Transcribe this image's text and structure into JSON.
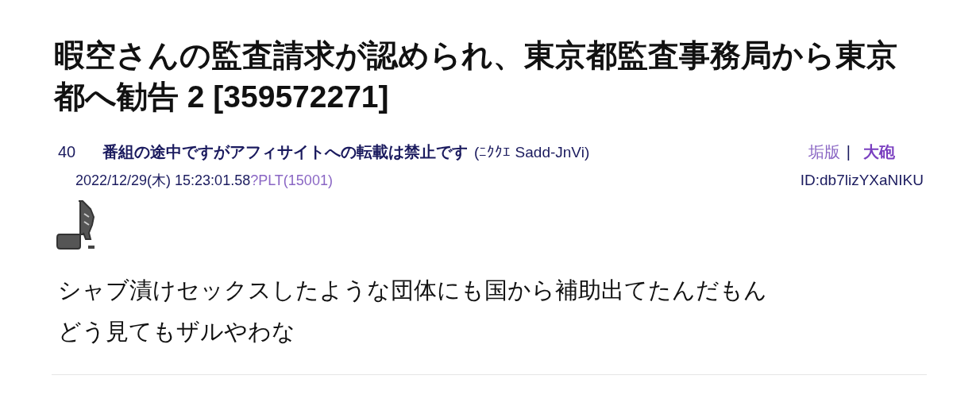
{
  "thread_title": "暇空さんの監査請求が認められ、東京都監査事務局から東京都へ勧告 2 [359572271]",
  "post": {
    "number": "40",
    "name": "番組の途中ですがアフィサイトへの転載は禁止です",
    "trip": "(ﾆｸｸｴ Sadd-JnVi)",
    "links": [
      {
        "label": "垢版",
        "bold": false
      },
      {
        "label": "大砲",
        "bold": true
      }
    ],
    "separator": "|",
    "date": "2022/12/29(木) 15:23:01.58",
    "plt": "?PLT(15001)",
    "id": "ID:db7lizYXaNIKU",
    "body": [
      "シャブ漬けセックスしたような団体にも国から補助出てたんだもん",
      "どう見てもザルやわな"
    ]
  }
}
